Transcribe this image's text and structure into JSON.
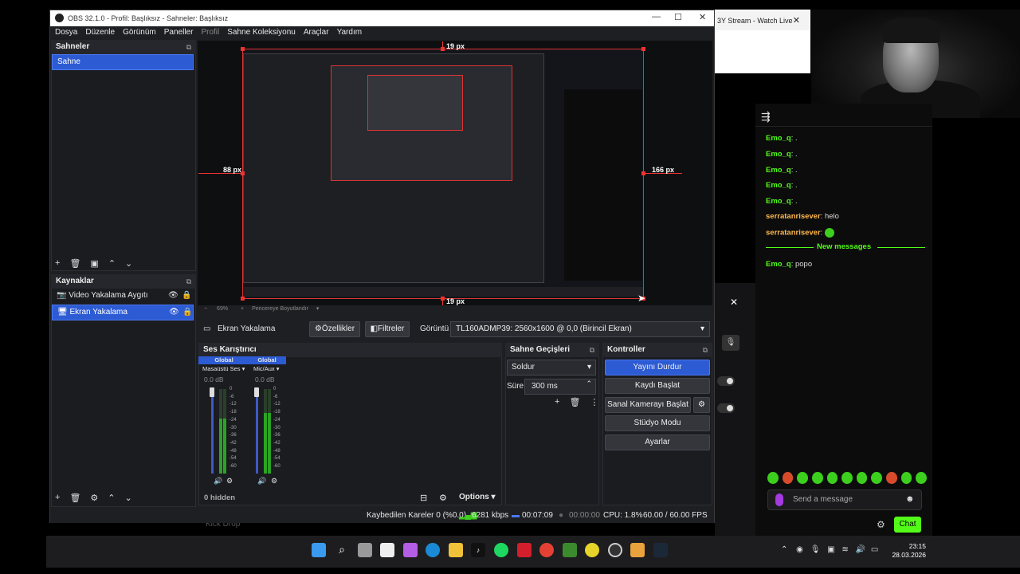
{
  "background": {
    "browser_tab_title": "3Y Stream - Watch Live",
    "browser_tab_close": "✕",
    "bottom_text": "Kick Drop"
  },
  "chat": {
    "messages": [
      {
        "user": "Emo_q",
        "text": "."
      },
      {
        "user": "Emo_q",
        "text": "."
      },
      {
        "user": "Emo_q",
        "text": "."
      },
      {
        "user": "Emo_q",
        "text": "."
      },
      {
        "user": "Emo_q",
        "text": "."
      },
      {
        "user": "serratanrisever",
        "text": "helo"
      },
      {
        "user": "serratanrisever",
        "text": ""
      },
      {
        "user": "Emo_q",
        "text": "popo"
      }
    ],
    "new_messages_label": "New messages",
    "input_placeholder": "Send a message",
    "send_button": "Chat",
    "colors": {
      "accent": "#53fc18",
      "user_alt": "#ffb84d"
    }
  },
  "obs": {
    "window_title": "OBS 32.1.0 - Profil: Başlıksız - Sahneler: Başlıksız",
    "menu": [
      "Dosya",
      "Düzenle",
      "Görünüm",
      "Paneller",
      "Profil",
      "Sahne Koleksiyonu",
      "Araçlar",
      "Yardım"
    ],
    "scenes": {
      "title": "Sahneler",
      "items": [
        "Sahne"
      ]
    },
    "sources": {
      "title": "Kaynaklar",
      "items": [
        {
          "name": "Video Yakalama Aygıtı",
          "icon": "camera-icon"
        },
        {
          "name": "Ekran Yakalama",
          "icon": "monitor-icon"
        }
      ]
    },
    "preview": {
      "guides": {
        "top": "19 px",
        "bottom": "19 px",
        "left": "88 px",
        "right": "166 px"
      },
      "zoom": "69%",
      "fit_label": "Pencereye Boyutlandır"
    },
    "source_bar": {
      "source_name": "Ekran Yakalama",
      "properties": "Özellikler",
      "filters": "Filtreler",
      "display_label": "Görüntü",
      "display_value": "TL160ADMP39: 2560x1600 @ 0,0 (Birincil Ekran)"
    },
    "mixer": {
      "title": "Ses Karıştırıcı",
      "channels": [
        {
          "tag": "Global",
          "name": "Masaüstü Ses",
          "db": "0.0 dB",
          "level": 0.65
        },
        {
          "tag": "Global",
          "name": "Mic/Aux",
          "db": "0.0 dB",
          "level": 0.72
        }
      ],
      "ticks": [
        "0",
        "-6",
        "-12",
        "-18",
        "-24",
        "-30",
        "-36",
        "-42",
        "-48",
        "-54",
        "-60"
      ],
      "hidden_label": "0 hidden",
      "options_label": "Options"
    },
    "transitions": {
      "title": "Sahne Geçişleri",
      "transition": "Soldur",
      "duration_label": "Süre",
      "duration": "300 ms"
    },
    "controls": {
      "title": "Kontroller",
      "stop_stream": "Yayını Durdur",
      "start_record": "Kaydı Başlat",
      "virtual_cam": "Sanal Kamerayı Başlat",
      "studio_mode": "Stüdyo Modu",
      "settings": "Ayarlar"
    },
    "status": {
      "dropped_frames": "Kaybedilen Kareler 0 (%0.0)",
      "bitrate": "6281 kbps",
      "stream_time": "00:07:09",
      "record_time": "00:00:00",
      "cpu": "CPU: 1.8%",
      "fps": "60.00 / 60.00 FPS"
    }
  },
  "taskbar": {
    "time": "23:15",
    "date": "28.03.2026",
    "icons": [
      "windows-start-icon",
      "search-icon",
      "task-view-icon",
      "store-icon",
      "copilot-icon",
      "edge-icon",
      "file-explorer-icon",
      "tiktok-icon",
      "spotify-icon",
      "app-red-icon",
      "chrome-icon",
      "minecraft-icon",
      "app-yellow-icon",
      "obs-icon",
      "app-bear-icon",
      "steam-icon"
    ]
  }
}
